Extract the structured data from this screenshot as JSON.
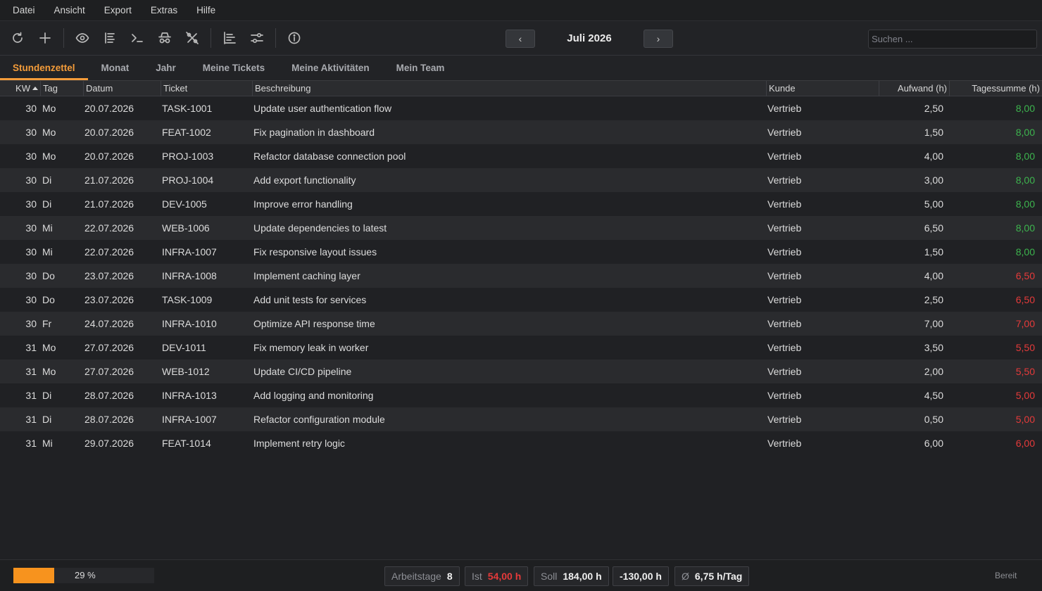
{
  "menu": [
    "Datei",
    "Ansicht",
    "Export",
    "Extras",
    "Hilfe"
  ],
  "toolbar": {
    "period": "Juli 2026",
    "search_placeholder": "Suchen ...",
    "prev_glyph": "‹",
    "next_glyph": "›"
  },
  "tabs": [
    "Stundenzettel",
    "Monat",
    "Jahr",
    "Meine Tickets",
    "Meine Aktivitäten",
    "Mein Team"
  ],
  "active_tab": "Stundenzettel",
  "columns": [
    "KW",
    "Tag",
    "Datum",
    "Ticket",
    "Beschreibung",
    "Kunde",
    "Aufwand (h)",
    "Tagessumme (h)"
  ],
  "sort": {
    "column": "KW",
    "direction": "asc"
  },
  "rows": [
    {
      "kw": "30",
      "tag": "Mo",
      "datum": "20.07.2026",
      "ticket": "TASK-1001",
      "beschreibung": "Update user authentication flow",
      "kunde": "Vertrieb",
      "aufwand": "2,50",
      "summe": "8,00",
      "status": "ok"
    },
    {
      "kw": "30",
      "tag": "Mo",
      "datum": "20.07.2026",
      "ticket": "FEAT-1002",
      "beschreibung": "Fix pagination in dashboard",
      "kunde": "Vertrieb",
      "aufwand": "1,50",
      "summe": "8,00",
      "status": "ok"
    },
    {
      "kw": "30",
      "tag": "Mo",
      "datum": "20.07.2026",
      "ticket": "PROJ-1003",
      "beschreibung": "Refactor database connection pool",
      "kunde": "Vertrieb",
      "aufwand": "4,00",
      "summe": "8,00",
      "status": "ok"
    },
    {
      "kw": "30",
      "tag": "Di",
      "datum": "21.07.2026",
      "ticket": "PROJ-1004",
      "beschreibung": "Add export functionality",
      "kunde": "Vertrieb",
      "aufwand": "3,00",
      "summe": "8,00",
      "status": "ok"
    },
    {
      "kw": "30",
      "tag": "Di",
      "datum": "21.07.2026",
      "ticket": "DEV-1005",
      "beschreibung": "Improve error handling",
      "kunde": "Vertrieb",
      "aufwand": "5,00",
      "summe": "8,00",
      "status": "ok"
    },
    {
      "kw": "30",
      "tag": "Mi",
      "datum": "22.07.2026",
      "ticket": "WEB-1006",
      "beschreibung": "Update dependencies to latest",
      "kunde": "Vertrieb",
      "aufwand": "6,50",
      "summe": "8,00",
      "status": "ok"
    },
    {
      "kw": "30",
      "tag": "Mi",
      "datum": "22.07.2026",
      "ticket": "INFRA-1007",
      "beschreibung": "Fix responsive layout issues",
      "kunde": "Vertrieb",
      "aufwand": "1,50",
      "summe": "8,00",
      "status": "ok"
    },
    {
      "kw": "30",
      "tag": "Do",
      "datum": "23.07.2026",
      "ticket": "INFRA-1008",
      "beschreibung": "Implement caching layer",
      "kunde": "Vertrieb",
      "aufwand": "4,00",
      "summe": "6,50",
      "status": "under"
    },
    {
      "kw": "30",
      "tag": "Do",
      "datum": "23.07.2026",
      "ticket": "TASK-1009",
      "beschreibung": "Add unit tests for services",
      "kunde": "Vertrieb",
      "aufwand": "2,50",
      "summe": "6,50",
      "status": "under"
    },
    {
      "kw": "30",
      "tag": "Fr",
      "datum": "24.07.2026",
      "ticket": "INFRA-1010",
      "beschreibung": "Optimize API response time",
      "kunde": "Vertrieb",
      "aufwand": "7,00",
      "summe": "7,00",
      "status": "under"
    },
    {
      "kw": "31",
      "tag": "Mo",
      "datum": "27.07.2026",
      "ticket": "DEV-1011",
      "beschreibung": "Fix memory leak in worker",
      "kunde": "Vertrieb",
      "aufwand": "3,50",
      "summe": "5,50",
      "status": "under"
    },
    {
      "kw": "31",
      "tag": "Mo",
      "datum": "27.07.2026",
      "ticket": "WEB-1012",
      "beschreibung": "Update CI/CD pipeline",
      "kunde": "Vertrieb",
      "aufwand": "2,00",
      "summe": "5,50",
      "status": "under"
    },
    {
      "kw": "31",
      "tag": "Di",
      "datum": "28.07.2026",
      "ticket": "INFRA-1013",
      "beschreibung": "Add logging and monitoring",
      "kunde": "Vertrieb",
      "aufwand": "4,50",
      "summe": "5,00",
      "status": "under"
    },
    {
      "kw": "31",
      "tag": "Di",
      "datum": "28.07.2026",
      "ticket": "INFRA-1007",
      "beschreibung": "Refactor configuration module",
      "kunde": "Vertrieb",
      "aufwand": "0,50",
      "summe": "5,00",
      "status": "under"
    },
    {
      "kw": "31",
      "tag": "Mi",
      "datum": "29.07.2026",
      "ticket": "FEAT-1014",
      "beschreibung": "Implement retry logic",
      "kunde": "Vertrieb",
      "aufwand": "6,00",
      "summe": "6,00",
      "status": "under"
    }
  ],
  "status": {
    "progress_fraction": 0.29,
    "progress_label": "29 %",
    "arbeitstage_label": "Arbeitstage",
    "arbeitstage": "8",
    "ist_label": "Ist",
    "ist": "54,00 h",
    "soll_label": "Soll",
    "soll": "184,00 h",
    "diff": "-130,00 h",
    "avg_label": "Ø",
    "avg": "6,75 h/Tag",
    "ready": "Bereit"
  },
  "colors": {
    "accent": "#f49c3a",
    "progress": "#f7931e",
    "ok": "#3db44e",
    "under": "#e53a3a"
  },
  "icons": [
    "refresh-icon",
    "add-icon",
    "eye-icon",
    "list-icon",
    "terminal-icon",
    "spy-icon",
    "percent-icon",
    "align-icon",
    "sliders-icon",
    "info-icon"
  ]
}
